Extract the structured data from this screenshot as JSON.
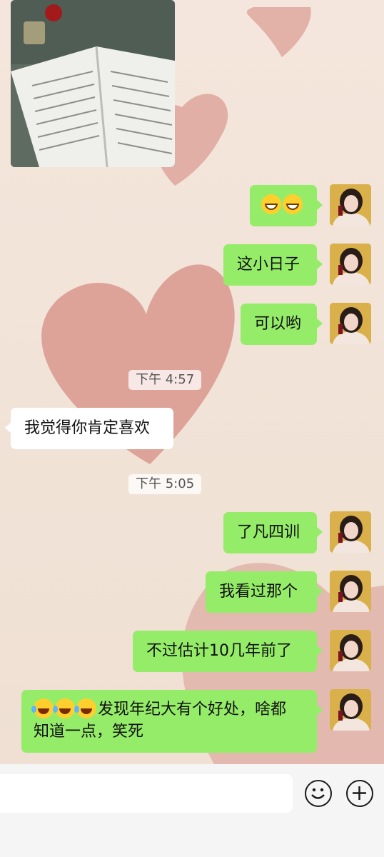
{
  "messages": {
    "m1": {
      "emoji": [
        "grin-emoji",
        "grin-emoji"
      ]
    },
    "m2": {
      "text": "这小日子"
    },
    "m3": {
      "text": "可以哟"
    },
    "m4": {
      "text": "我觉得你肯定喜欢"
    },
    "m5": {
      "text": "了凡四训"
    },
    "m6": {
      "text": "我看过那个"
    },
    "m7": {
      "text": "不过估计10几年前了"
    },
    "m8": {
      "line1": "发现年纪大有个好处，啥都",
      "line2": "知道一点，笑死",
      "emoji": [
        "laughing-tears-emoji",
        "laughing-tears-emoji",
        "laughing-tears-emoji"
      ]
    }
  },
  "timestamps": {
    "t1": "下午 4:57",
    "t2": "下午 5:05"
  },
  "input": {
    "placeholder": "",
    "value": ""
  },
  "icons": {
    "emoji_button": "smiley-icon",
    "more_button": "plus-icon"
  },
  "colors": {
    "outgoing_bubble": "#95ec69",
    "incoming_bubble": "#ffffff",
    "background": "#f0e2d6"
  }
}
